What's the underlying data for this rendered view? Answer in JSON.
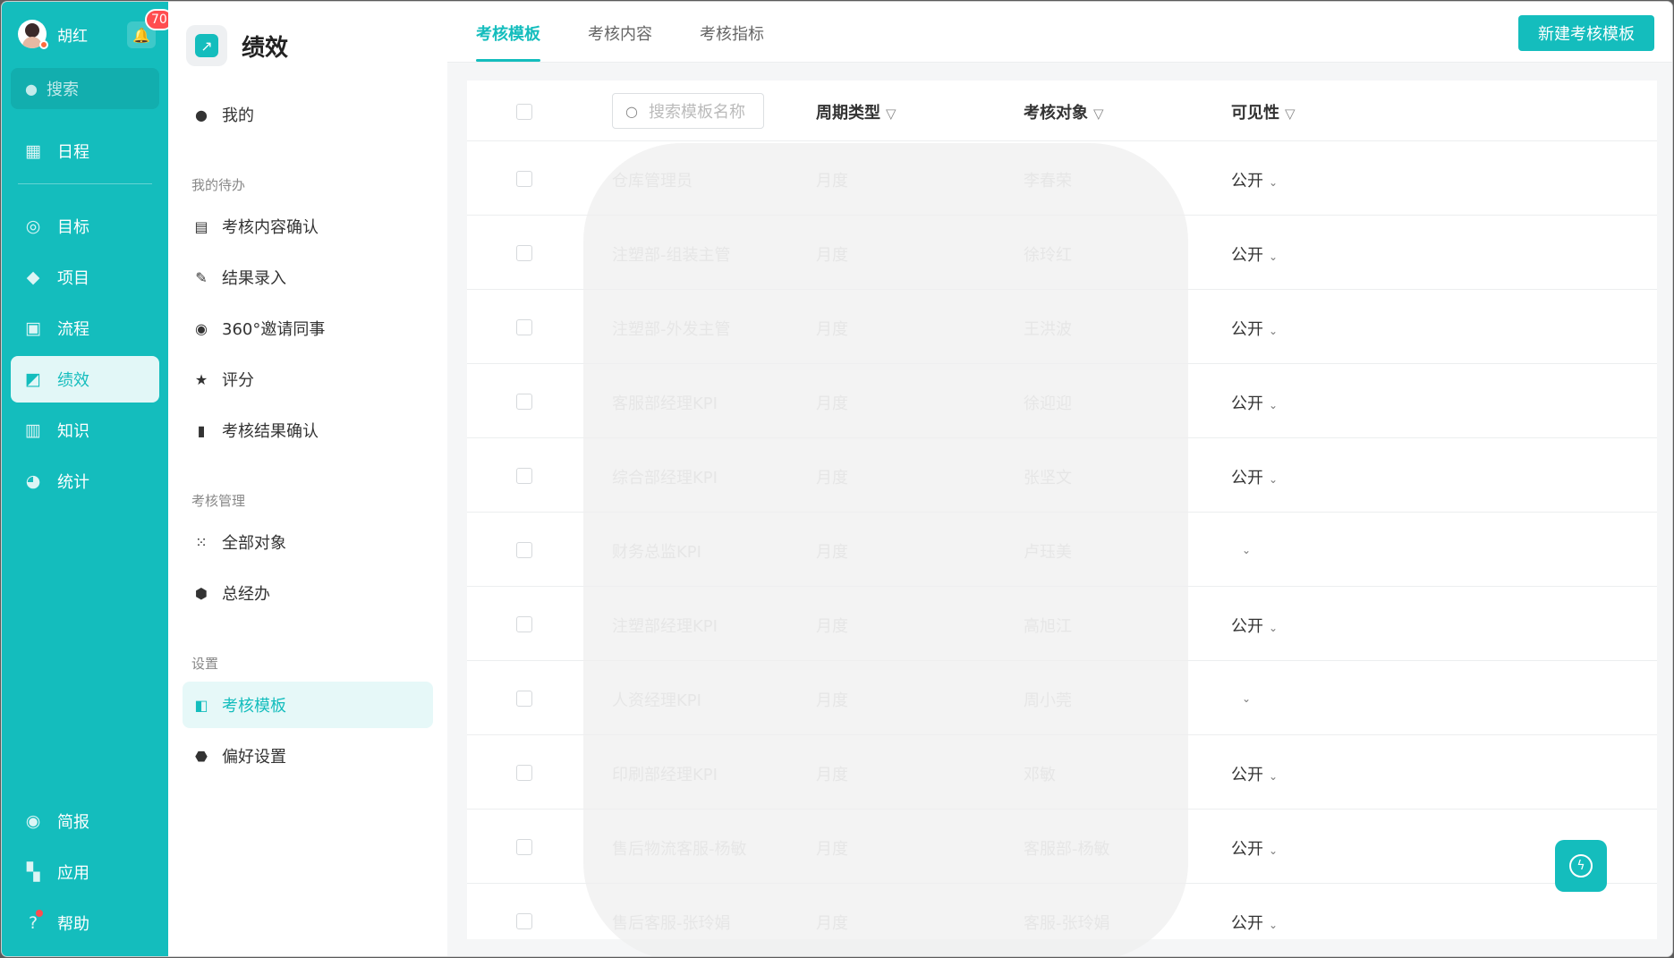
{
  "user": {
    "name": "胡红",
    "notifications": "70"
  },
  "nav": {
    "search_label": "搜索",
    "items": [
      {
        "label": "日程",
        "icon": "calendar-icon"
      },
      {
        "label": "目标",
        "icon": "target-icon"
      },
      {
        "label": "项目",
        "icon": "cube-icon"
      },
      {
        "label": "流程",
        "icon": "flow-icon"
      },
      {
        "label": "绩效",
        "icon": "performance-icon"
      },
      {
        "label": "知识",
        "icon": "book-icon"
      },
      {
        "label": "统计",
        "icon": "pie-chart-icon"
      }
    ],
    "bottom_items": [
      {
        "label": "简报",
        "icon": "brief-icon"
      },
      {
        "label": "应用",
        "icon": "apps-icon"
      },
      {
        "label": "帮助",
        "icon": "help-icon"
      }
    ],
    "active_item": "绩效"
  },
  "sub_menu": {
    "title": "绩效",
    "mine": "我的",
    "group_todo": "我的待办",
    "todo_items": [
      "考核内容确认",
      "结果录入",
      "360°邀请同事",
      "评分",
      "考核结果确认"
    ],
    "group_manage": "考核管理",
    "manage_items": [
      "全部对象",
      "总经办"
    ],
    "group_settings": "设置",
    "settings_items": [
      "考核模板",
      "偏好设置"
    ],
    "active_item": "考核模板"
  },
  "tabs": [
    "考核模板",
    "考核内容",
    "考核指标"
  ],
  "active_tab": "考核模板",
  "new_button": "新建考核模板",
  "table": {
    "search_placeholder": "搜索模板名称",
    "headers": {
      "period": "周期类型",
      "target": "考核对象",
      "visibility": "可见性"
    },
    "rows": [
      {
        "name": "仓库管理员",
        "period": "月度",
        "target": "李春荣",
        "visibility": "公开"
      },
      {
        "name": "注塑部-组装主管",
        "period": "月度",
        "target": "徐玲红",
        "visibility": "公开"
      },
      {
        "name": "注塑部-外发主管",
        "period": "月度",
        "target": "王洪波",
        "visibility": "公开"
      },
      {
        "name": "客服部经理KPI",
        "period": "月度",
        "target": "徐迎迎",
        "visibility": "公开"
      },
      {
        "name": "综合部经理KPI",
        "period": "月度",
        "target": "张坚文",
        "visibility": "公开"
      },
      {
        "name": "财务总监KPI",
        "period": "月度",
        "target": "卢珏美",
        "visibility": ""
      },
      {
        "name": "注塑部经理KPI",
        "period": "月度",
        "target": "高旭江",
        "visibility": "公开"
      },
      {
        "name": "人资经理KPI",
        "period": "月度",
        "target": "周小莞",
        "visibility": ""
      },
      {
        "name": "印刷部经理KPI",
        "period": "月度",
        "target": "邓敏",
        "visibility": "公开"
      },
      {
        "name": "售后物流客服-杨敏",
        "period": "月度",
        "target": "客服部-杨敏",
        "visibility": "公开"
      },
      {
        "name": "售后客服-张玲娟",
        "period": "月度",
        "target": "客服-张玲娟",
        "visibility": "公开"
      }
    ]
  },
  "colors": {
    "brand": "#14bdbd",
    "active_bg": "#e6f8f8"
  }
}
